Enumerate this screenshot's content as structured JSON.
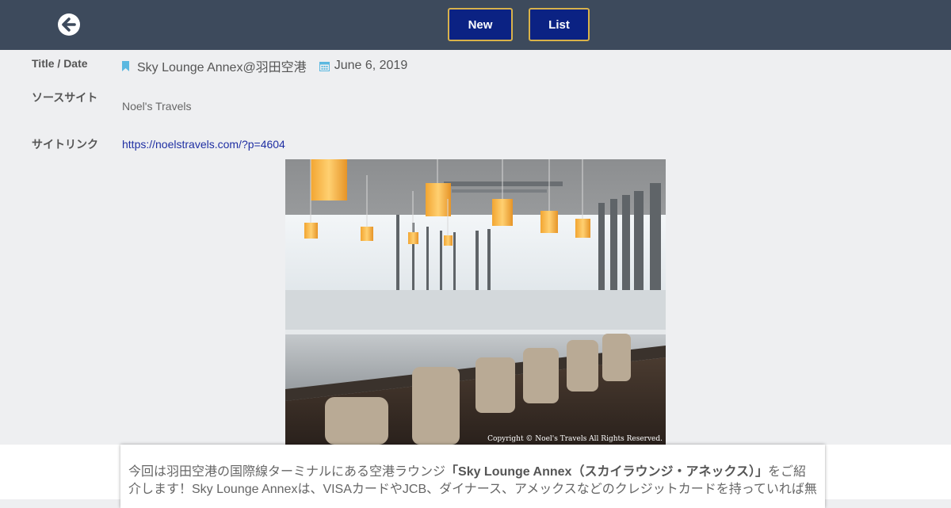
{
  "header": {
    "new_label": "New",
    "list_label": "List"
  },
  "labels": {
    "title_date": "Title / Date",
    "source_site": "ソースサイト",
    "site_link": "サイトリンク"
  },
  "entry": {
    "title": "Sky Lounge Annex@羽田空港",
    "date": "June 6, 2019",
    "source": "Noel's Travels",
    "link": "https://noelstravels.com/?p=4604"
  },
  "photo": {
    "copyright": "Copyright © Noel's Travels All Rights Reserved."
  },
  "article": {
    "intro": "今回は羽田空港の国際線ターミナルにある空港ラウンジ",
    "highlight": "「Sky Lounge Annex（スカイラウンジ・アネックス）」",
    "outro": "をご紹介します！Sky Lounge Annexは、VISAカードやJCB、ダイナース、アメックスなどのクレジットカードを持っていれば無"
  },
  "icons": {
    "back": "arrow-left-circle",
    "bookmark": "bookmark",
    "calendar": "calendar"
  },
  "colors": {
    "topbar": "#3d4a5c",
    "button_bg": "#0b2283",
    "button_border": "#d9b24a",
    "link": "#1f2fa3",
    "icon_blue": "#5bb8e0"
  }
}
